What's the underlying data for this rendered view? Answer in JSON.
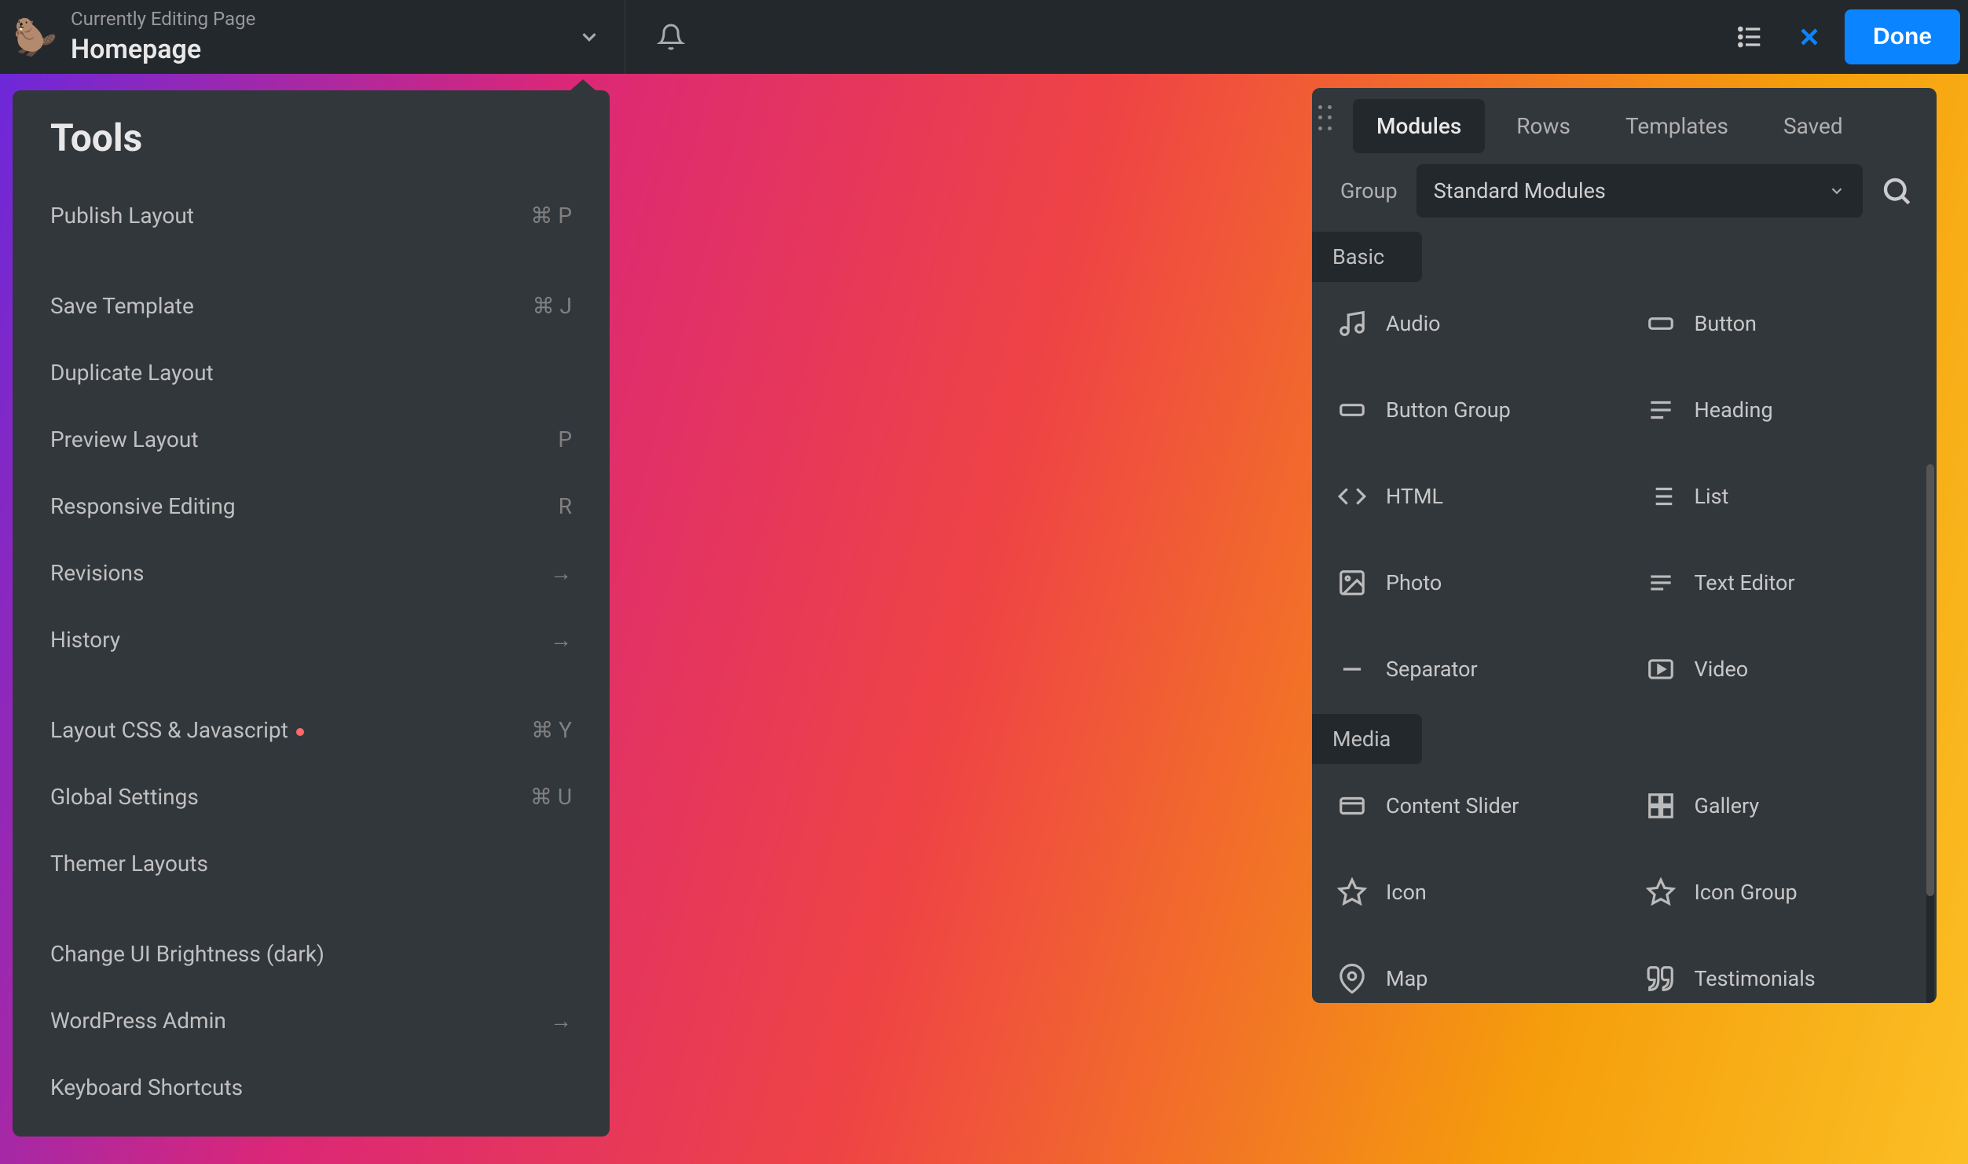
{
  "topbar": {
    "editing_label": "Currently Editing Page",
    "page_title": "Homepage",
    "done_label": "Done"
  },
  "tools": {
    "title": "Tools",
    "items": [
      {
        "label": "Publish Layout",
        "shortcut": "⌘ P"
      },
      {
        "label": "Save Template",
        "shortcut": "⌘ J",
        "gap_before": true
      },
      {
        "label": "Duplicate Layout",
        "shortcut": ""
      },
      {
        "label": "Preview Layout",
        "shortcut": "P"
      },
      {
        "label": "Responsive Editing",
        "shortcut": "R"
      },
      {
        "label": "Revisions",
        "shortcut": "→"
      },
      {
        "label": "History",
        "shortcut": "→"
      },
      {
        "label": "Layout CSS & Javascript",
        "shortcut": "⌘ Y",
        "dot": true,
        "gap_before": true
      },
      {
        "label": "Global Settings",
        "shortcut": "⌘ U"
      },
      {
        "label": "Themer Layouts",
        "shortcut": ""
      },
      {
        "label": "Change UI Brightness (dark)",
        "shortcut": "",
        "gap_before": true
      },
      {
        "label": "WordPress Admin",
        "shortcut": "→"
      },
      {
        "label": "Keyboard Shortcuts",
        "shortcut": ""
      }
    ]
  },
  "panel": {
    "tabs": [
      {
        "label": "Modules",
        "active": true
      },
      {
        "label": "Rows"
      },
      {
        "label": "Templates"
      },
      {
        "label": "Saved"
      }
    ],
    "group_label": "Group",
    "group_selected": "Standard Modules",
    "sections": [
      {
        "title": "Basic",
        "modules": [
          {
            "name": "Audio",
            "icon": "music"
          },
          {
            "name": "Button",
            "icon": "button"
          },
          {
            "name": "Button Group",
            "icon": "button"
          },
          {
            "name": "Heading",
            "icon": "heading"
          },
          {
            "name": "HTML",
            "icon": "code"
          },
          {
            "name": "List",
            "icon": "list"
          },
          {
            "name": "Photo",
            "icon": "image"
          },
          {
            "name": "Text Editor",
            "icon": "text"
          },
          {
            "name": "Separator",
            "icon": "minus"
          },
          {
            "name": "Video",
            "icon": "video"
          }
        ]
      },
      {
        "title": "Media",
        "modules": [
          {
            "name": "Content Slider",
            "icon": "slider"
          },
          {
            "name": "Gallery",
            "icon": "gallery"
          },
          {
            "name": "Icon",
            "icon": "star"
          },
          {
            "name": "Icon Group",
            "icon": "star"
          },
          {
            "name": "Map",
            "icon": "pin"
          },
          {
            "name": "Testimonials",
            "icon": "quote"
          }
        ]
      }
    ]
  },
  "colors": {
    "accent": "#0a84ff"
  }
}
